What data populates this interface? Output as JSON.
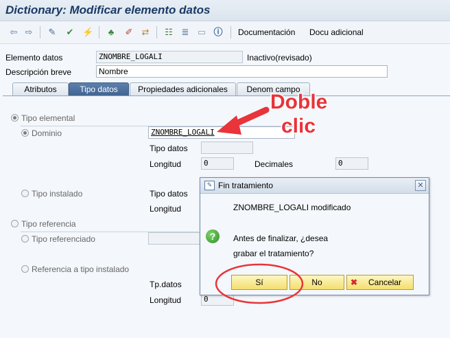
{
  "window": {
    "title": "Dictionary: Modificar elemento datos"
  },
  "toolbar": {
    "documentacion": "Documentación",
    "docu_adicional": "Docu adicional"
  },
  "header": {
    "elemento_datos_label": "Elemento datos",
    "elemento_datos_value": "ZNOMBRE_LOGALI",
    "status": "Inactivo(revisado)",
    "descripcion_label": "Descripción breve",
    "descripcion_value": "Nombre"
  },
  "tabs": [
    {
      "label": "Atributos"
    },
    {
      "label": "Tipo datos"
    },
    {
      "label": "Propiedades adicionales"
    },
    {
      "label": "Denom campo"
    }
  ],
  "form": {
    "tipo_elemental": "Tipo elemental",
    "dominio": "Dominio",
    "dominio_value": "ZNOMBRE_LOGALI",
    "tipo_datos": "Tipo datos",
    "longitud": "Longitud",
    "longitud_value": "0",
    "decimales": "Decimales",
    "decimales_value": "0",
    "tipo_instalado": "Tipo instalado",
    "tipo_datos_2": "Tipo datos",
    "longitud_2": "Longitud",
    "tipo_referencia": "Tipo referencia",
    "tipo_referenciado": "Tipo referenciado",
    "referencia_tipo_instalado": "Referencia a tipo instalado",
    "tp_datos": "Tp.datos",
    "longitud_3": "Longitud",
    "longitud_3_value": "0"
  },
  "annotation": {
    "line1": "Doble",
    "line2": "clic",
    "color": "#e8343a"
  },
  "dialog": {
    "title": "Fin tratamiento",
    "modified": "ZNOMBRE_LOGALI modificado",
    "question_line1": "Antes de finalizar, ¿desea",
    "question_line2": "grabar el tratamiento?",
    "btn_si": "Sí",
    "btn_no": "No",
    "btn_cancelar": "Cancelar"
  }
}
